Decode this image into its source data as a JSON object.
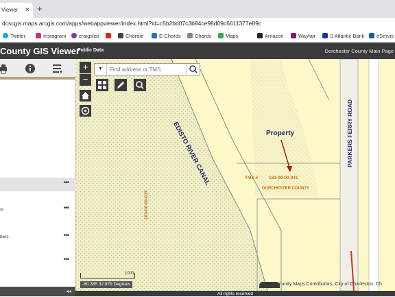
{
  "browser": {
    "tab_title": "Viewer",
    "tab_close": "✕",
    "new_tab": "+",
    "url": "dcscgis.maps.arcgis.com/apps/webappviewer/index.html?id=c5b2bd07c3b84ce98d09c6611377e89c"
  },
  "bookmarks": [
    {
      "label": "Twitter",
      "color": "#1da1f2"
    },
    {
      "label": "Instagram",
      "color": "#c13584"
    },
    {
      "label": "craigslist",
      "color": "#7a3e9d"
    },
    {
      "label": "",
      "color": "#e62117"
    },
    {
      "label": "Chordie",
      "color": "#444444"
    },
    {
      "label": "E-Chords",
      "color": "#2a6ebb"
    },
    {
      "label": "Chords",
      "color": "#888888"
    },
    {
      "label": "Maps",
      "color": "#34a853"
    },
    {
      "label": "Amazon",
      "color": "#222222"
    },
    {
      "label": "Wayfair",
      "color": "#7f187f"
    },
    {
      "label": "S Atlantic Bank",
      "color": "#0b3d91"
    },
    {
      "label": "eServis",
      "color": "#1b5aa6"
    }
  ],
  "header": {
    "title": "County GIS Viewer",
    "public_data": "Public Data",
    "main_page_link": "Dorchester County Main Page"
  },
  "panel": {
    "rows": [
      {
        "label": "",
        "selected": true,
        "more": "•••"
      },
      {
        "label": "st",
        "selected": false,
        "more": "•••"
      },
      {
        "label": "bers",
        "selected": false,
        "more": "•••"
      },
      {
        "label": "",
        "selected": false,
        "more": "•••"
      }
    ],
    "collapse": "◂◂"
  },
  "map": {
    "search_placeholder": "Find address or TMS",
    "zoom_in": "+",
    "zoom_out": "−",
    "labels": {
      "canal": "EDISTO RIVER CANAL",
      "road": "PARKERS FERRY ROAD",
      "property": "Property",
      "tms_prefix": "TMS #",
      "tms_number": "183-00-00-041",
      "county": "DORCHESTER COUNTY",
      "parcel": "183-00-00-015"
    },
    "scale_label": "100ft",
    "coordinates": "-80.385 32.879 Degrees",
    "credits": "Community Maps Contributors, City of Charleston, Ch",
    "footer": "All rights reserved"
  },
  "colors": {
    "header": "#3b3b3b",
    "map_background": "#fdf8c8",
    "wetland_pattern": "#b8c8a0",
    "label_orange": "#c8701e",
    "label_navy": "#1c2a6b",
    "arrow": "#b01818"
  }
}
